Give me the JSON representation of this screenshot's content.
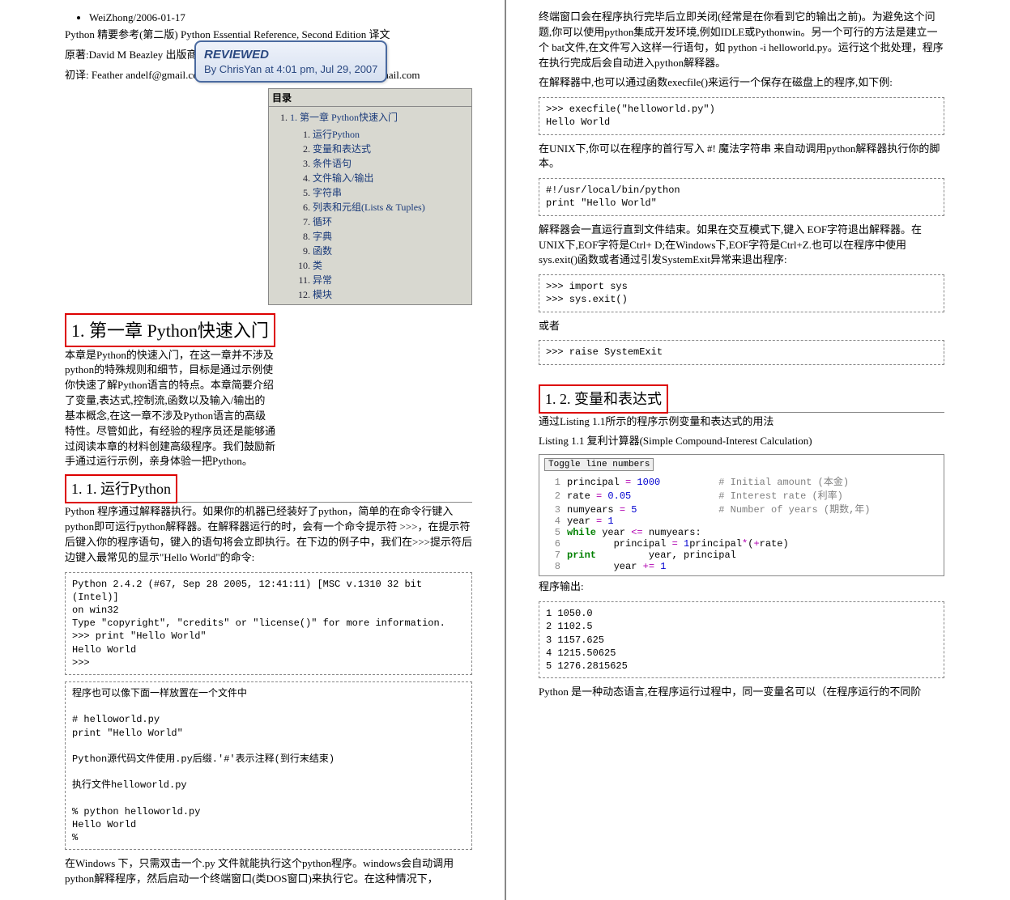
{
  "meta": {
    "authorLine": "WeiZhong/2006-01-17",
    "stampTitle": "REVIEWED",
    "stampBy": "By ChrisYan at 4:01 pm, Jul 29, 2007",
    "title": "Python 精要参考(第二版) Python Essential Reference, Second Edition 译文",
    "orig": "原著:David M Beazley 出版商: New Riders Publishing",
    "trans": "初译: Feather andelf@gmail.com 修正补充: WeiZhong weizhong2004@gmail.com"
  },
  "sec1": {
    "heading": "1. 第一章 Python快速入门",
    "intro": "本章是Python的快速入门，在这一章并不涉及 python的特殊规则和细节，目标是通过示例使你快速了解Python语言的特点。本章简要介绍了变量,表达式,控制流,函数以及输入/输出的基本概念,在这一章不涉及Python语言的高级特性。尽管如此，有经验的程序员还是能够通过阅读本章的材料创建高级程序。我们鼓励新手通过运行示例，亲身体验一把Python。"
  },
  "toc": {
    "title": "目录",
    "top": "1. 第一章 Python快速入门",
    "items": [
      "运行Python",
      "变量和表达式",
      "条件语句",
      "文件输入/输出",
      "字符串",
      "列表和元组(Lists & Tuples)",
      "循环",
      "字典",
      "函数",
      "类",
      "异常",
      "模块"
    ]
  },
  "sec11": {
    "heading": "1. 1. 运行Python",
    "p1": "Python 程序通过解释器执行。如果你的机器已经装好了python，简单的在命令行键入python即可运行python解释器。在解释器运行的时，会有一个命令提示符 >>>，在提示符后键入你的程序语句，键入的语句将会立即执行。在下边的例子中，我们在>>>提示符后边键入最常见的显示\"Hello World\"的命令:",
    "code1": "Python 2.4.2 (#67, Sep 28 2005, 12:41:11) [MSC v.1310 32 bit (Intel)]\non win32\nType \"copyright\", \"credits\" or \"license()\" for more information.\n>>> print \"Hello World\"\nHello World\n>>>",
    "p2a": "程序也可以像下面一样放置在一个文件中",
    "p2b": "# helloworld.py\nprint \"Hello World\"",
    "p2c": "Python源代码文件使用.py后缀.'#'表示注释(到行末结束)",
    "p2d": "执行文件helloworld.py",
    "p2e": "% python helloworld.py\nHello World\n%",
    "p3": "在Windows 下，只需双击一个.py 文件就能执行这个python程序。windows会自动调用python解释程序，然后启动一个终端窗口(类DOS窗口)来执行它。在这种情况下，"
  },
  "right": {
    "p1": "终端窗口会在程序执行完毕后立即关闭(经常是在你看到它的输出之前)。为避免这个问题,你可以使用python集成开发环境,例如IDLE或Pythonwin。另一个可行的方法是建立一个 bat文件,在文件写入这样一行语句，如 python -i helloworld.py。运行这个批处理，程序在执行完成后会自动进入python解释器。",
    "p2": "在解释器中,也可以通过函数execfile()来运行一个保存在磁盘上的程序,如下例:",
    "code1": ">>> execfile(\"helloworld.py\")\nHello World",
    "p3": "在UNIX下,你可以在程序的首行写入 #! 魔法字符串 来自动调用python解释器执行你的脚本。",
    "code2": "#!/usr/local/bin/python\nprint \"Hello World\"",
    "p4": "解释器会一直运行直到文件结束。如果在交互模式下,键入 EOF字符退出解释器。在UNIX下,EOF字符是Ctrl+ D;在Windows下,EOF字符是Ctrl+Z.也可以在程序中使用sys.exit()函数或者通过引发SystemExit异常来退出程序:",
    "code3": ">>> import sys\n>>> sys.exit()",
    "p5": "或者",
    "code4": ">>> raise SystemExit"
  },
  "sec12": {
    "heading": "1. 2. 变量和表达式",
    "p1": "通过Listing 1.1所示的程序示例变量和表达式的用法",
    "caption": "Listing 1.1 复利计算器(Simple Compound-Interest Calculation)",
    "toggle": "Toggle line numbers",
    "lines": [
      {
        "n": "1",
        "t": "principal ",
        "op": "= ",
        "num": "1000",
        "pad": "          ",
        "cm": "# Initial amount (本金)"
      },
      {
        "n": "2",
        "t": "rate ",
        "op": "= ",
        "num": "0.05",
        "pad": "               ",
        "cm": "# Interest rate (利率)"
      },
      {
        "n": "3",
        "t": "numyears ",
        "op": "= ",
        "num": "5",
        "pad": "              ",
        "cm": "# Number of years (期数,年)"
      },
      {
        "n": "4",
        "t": "year ",
        "op": "= ",
        "num": "1",
        "pad": "",
        "cm": ""
      },
      {
        "n": "5",
        "kw": "while ",
        "t": "year ",
        "op": "<= ",
        "t2": "numyears:",
        "pad": "",
        "cm": ""
      },
      {
        "n": "6",
        "t": "        principal ",
        "op": "= ",
        "t2": "principal",
        "op2": "*",
        "t3": "(",
        "num": "1",
        "op3": "+",
        "t4": "rate)",
        "pad": "",
        "cm": ""
      },
      {
        "n": "7",
        "t": "        ",
        "kw": "print ",
        "t2": "year, principal",
        "pad": "",
        "cm": ""
      },
      {
        "n": "8",
        "t": "        year ",
        "op": "+= ",
        "num": "1",
        "pad": "",
        "cm": ""
      }
    ],
    "outputLabel": "程序输出:",
    "output": "1 1050.0\n2 1102.5\n3 1157.625\n4 1215.50625\n5 1276.2815625",
    "p2": "Python 是一种动态语言,在程序运行过程中，同一变量名可以（在程序运行的不同阶"
  }
}
